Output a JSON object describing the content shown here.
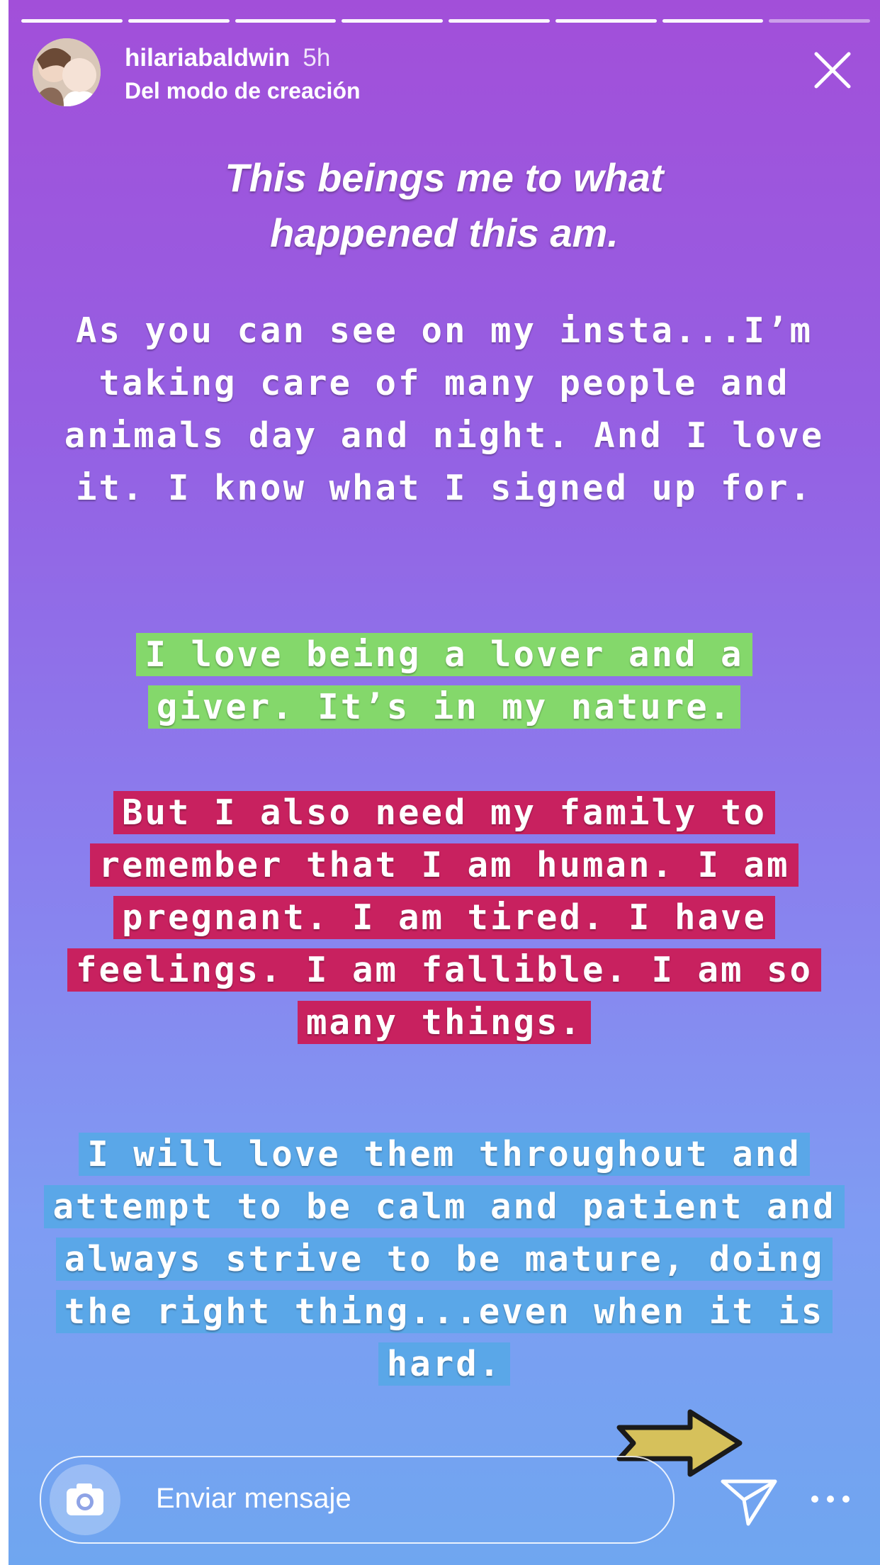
{
  "story": {
    "username": "hilariabaldwin",
    "time": "5h",
    "subtitle": "Del modo de creación",
    "segments": 8,
    "active_segment": 7
  },
  "icons": {
    "close": "close-icon",
    "camera": "camera-icon",
    "send": "send-icon",
    "more": "more-icon",
    "arrow": "arrow-sticker"
  },
  "colors": {
    "highlight_green": "#84d86b",
    "highlight_red": "#c8215f",
    "highlight_blue": "#5aa7e8"
  },
  "content": {
    "title": "This beings me to what happened this am.",
    "para1": "As you can see on my insta...I’m taking care of many people and animals day and night. And I love it. I know what I signed up for.",
    "para2": "I love being a lover and a giver. It’s in my nature.",
    "para3": "But I also need my family to remember that I am human. I am pregnant. I am tired. I have feelings. I am fallible. I am so many things.",
    "para4": "I will love them throughout and attempt to be calm and patient and always strive to be mature, doing the right thing...even when it is hard."
  },
  "reply": {
    "placeholder": "Enviar mensaje"
  }
}
